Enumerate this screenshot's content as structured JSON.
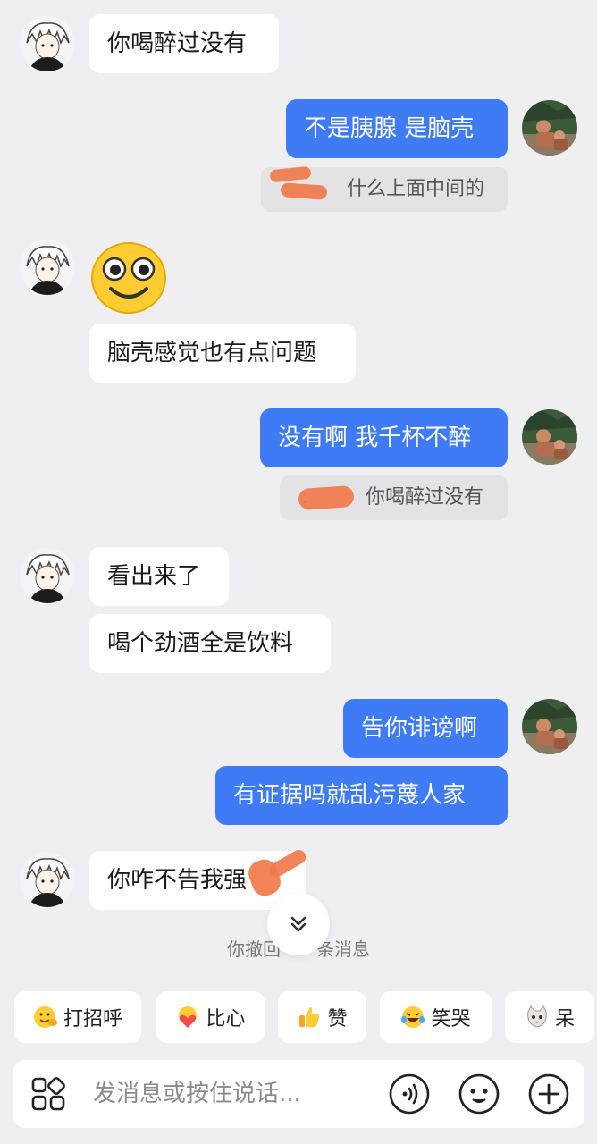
{
  "messages": {
    "m1": "你喝醉过没有",
    "m2": "不是胰腺 是脑壳",
    "q1_text": "什么上面中间的",
    "m3": "脑壳感觉也有点问题",
    "m4": "没有啊 我千杯不醉",
    "q2_text": "你喝醉过没有",
    "m5": "看出来了",
    "m6": "喝个劲酒全是饮料",
    "m7": "告你诽谤啊",
    "m8": "有证据吗就乱污蔑人家",
    "m9": "你咋不告我强"
  },
  "system": {
    "recall_prefix": "你撤回",
    "recall_suffix": "条消息"
  },
  "quick_replies": [
    {
      "label": "打招呼",
      "icon": "wave-face-icon"
    },
    {
      "label": "比心",
      "icon": "heart-hands-icon"
    },
    {
      "label": "赞",
      "icon": "thumbs-up-icon"
    },
    {
      "label": "笑哭",
      "icon": "tears-of-joy-icon"
    },
    {
      "label": "呆",
      "icon": "cat-face-icon"
    }
  ],
  "input": {
    "placeholder": "发消息或按住说话..."
  },
  "colors": {
    "background": "#efeff1",
    "outgoing_bubble": "#3e7bf5",
    "incoming_bubble": "#ffffff",
    "quote_bg": "#e3e3e6",
    "redaction": "#f07a4a"
  }
}
